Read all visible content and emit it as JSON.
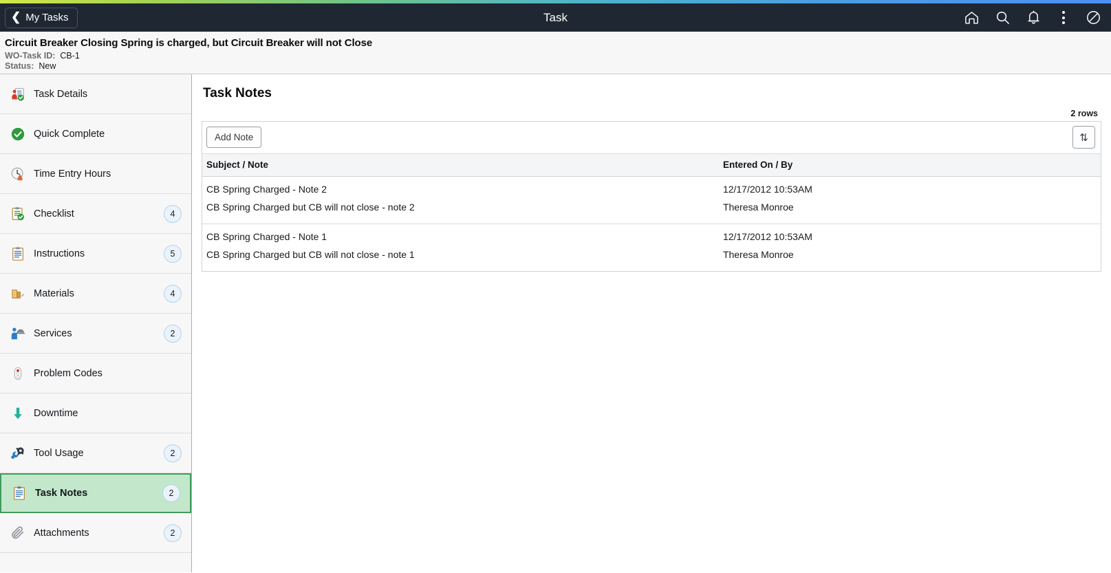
{
  "topbar": {
    "back_label": "My Tasks",
    "back_icon": "chevron-left-icon",
    "title": "Task",
    "icons": [
      {
        "name": "home-icon",
        "label": "Home"
      },
      {
        "name": "search-icon",
        "label": "Search"
      },
      {
        "name": "notifications-bell-icon",
        "label": "Notifications"
      },
      {
        "name": "actions-menu-icon",
        "label": "Actions"
      },
      {
        "name": "navigator-compass-icon",
        "label": "NavBar"
      }
    ]
  },
  "subheader": {
    "task_title": "Circuit Breaker Closing Spring is charged, but Circuit Breaker will not Close",
    "wo_task_id_label": "WO-Task ID:",
    "wo_task_id_value": "CB-1",
    "status_label": "Status:",
    "status_value": "New"
  },
  "sidebar": {
    "items": [
      {
        "label": "Task Details",
        "icon": "task-details-icon",
        "badge": "",
        "selected": false
      },
      {
        "label": "Quick Complete",
        "icon": "check-circle-icon",
        "badge": "",
        "selected": false
      },
      {
        "label": "Time Entry Hours",
        "icon": "clock-person-icon",
        "badge": "",
        "selected": false
      },
      {
        "label": "Checklist",
        "icon": "checklist-icon",
        "badge": "4",
        "selected": false
      },
      {
        "label": "Instructions",
        "icon": "instructions-icon",
        "badge": "5",
        "selected": false
      },
      {
        "label": "Materials",
        "icon": "materials-icon",
        "badge": "4",
        "selected": false
      },
      {
        "label": "Services",
        "icon": "services-icon",
        "badge": "2",
        "selected": false
      },
      {
        "label": "Problem Codes",
        "icon": "traffic-light-icon",
        "badge": "",
        "selected": false
      },
      {
        "label": "Downtime",
        "icon": "down-arrow-icon",
        "badge": "",
        "selected": false
      },
      {
        "label": "Tool Usage",
        "icon": "tools-icon",
        "badge": "2",
        "selected": false
      },
      {
        "label": "Task Notes",
        "icon": "notes-clipboard-icon",
        "badge": "2",
        "selected": true
      },
      {
        "label": "Attachments",
        "icon": "paperclip-icon",
        "badge": "2",
        "selected": false
      }
    ]
  },
  "main": {
    "panel_title": "Task Notes",
    "rows_count": "2 rows",
    "add_note_label": "Add Note",
    "sort_icon_glyph": "⇅",
    "columns": {
      "subject": "Subject / Note",
      "entered": "Entered On / By"
    },
    "rows": [
      {
        "subject": "CB Spring Charged - Note 2",
        "note": "CB Spring Charged but CB will not close - note 2",
        "entered_on": "12/17/2012 10:53AM",
        "entered_by": "Theresa Monroe"
      },
      {
        "subject": "CB Spring Charged - Note 1",
        "note": "CB Spring Charged but CB will not close - note 1",
        "entered_on": "12/17/2012 10:53AM",
        "entered_by": "Theresa Monroe"
      }
    ]
  },
  "colors": {
    "topbar_bg": "#1f2733",
    "selected_item_bg": "#c3e7cb",
    "selected_item_border": "#3e9c5c",
    "badge_bg": "#eaf3fb",
    "badge_border": "#b3d2ec"
  }
}
